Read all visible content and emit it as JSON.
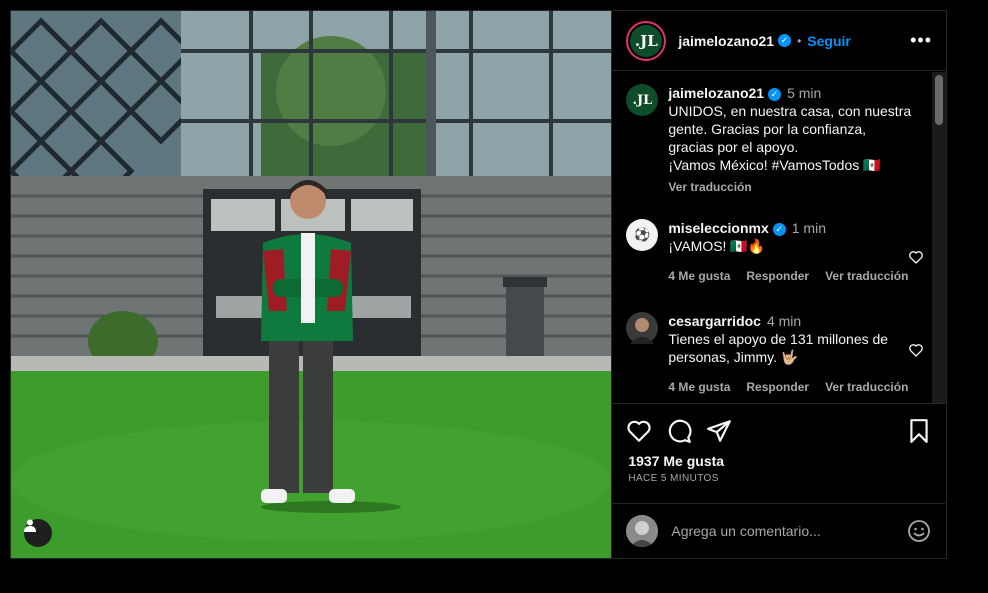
{
  "post": {
    "author": "jaimelozano21",
    "author_initials": ".JL",
    "follow_label": "Seguir",
    "caption_lines": [
      "UNIDOS, en nuestra casa, con nuestra",
      "gente. Gracias por la confianza,",
      "gracias por el apoyo.",
      "¡Vamos México! #VamosTodos 🇲🇽"
    ],
    "caption_time": "5 min",
    "see_translation": "Ver traducción",
    "likes": "1937 Me gusta",
    "posted_ago": "HACE 5 MINUTOS"
  },
  "comments": [
    {
      "username": "miseleccionmx",
      "verified": true,
      "time": "1 min",
      "text": "¡VAMOS! 🇲🇽🔥",
      "likes": "4 Me gusta",
      "reply": "Responder",
      "translate": "Ver traducción"
    },
    {
      "username": "cesargarridoc",
      "verified": false,
      "time": "4 min",
      "text_lines": [
        "Tienes el apoyo de 131 millones de",
        "personas, Jimmy. 🤟🏼"
      ],
      "likes": "4 Me gusta",
      "reply": "Responder",
      "translate": "Ver traducción"
    }
  ],
  "composer": {
    "placeholder": "Agrega un comentario..."
  },
  "icons": [
    "more-icon",
    "verified-icon",
    "heart-icon",
    "comment-icon",
    "share-icon",
    "save-icon",
    "emoji-icon",
    "user-tag-icon"
  ],
  "colors": {
    "accent": "#0095f6",
    "background": "#000000",
    "muted": "#a8a8a8"
  }
}
